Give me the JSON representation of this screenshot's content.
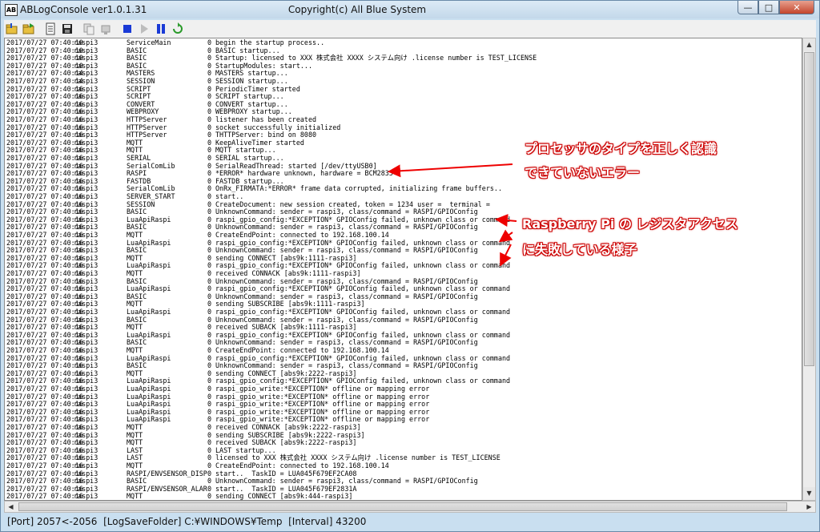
{
  "window": {
    "app_title": "ABLogConsole ver1.0.1.31",
    "copyright": "Copyright(c) All Blue System",
    "app_icon_text": "AB",
    "min_label": "—",
    "max_label": "□",
    "close_label": "✕"
  },
  "toolbar": {
    "icons": [
      "folder-open-icon",
      "folder-save-icon",
      "new-doc-icon",
      "save-disk-icon",
      "copy-icon",
      "connect-icon",
      "stop-icon",
      "play-icon",
      "pause-icon",
      "refresh-icon"
    ]
  },
  "colors": {
    "stop": "#1a3ad6",
    "annotation_outline": "#cc0000"
  },
  "log": [
    [
      "2017/07/27 07:40:10",
      "raspi3",
      "ServiceMain",
      "0",
      "begin the startup process.."
    ],
    [
      "2017/07/27 07:40:10",
      "raspi3",
      "BASIC",
      "0",
      "BASIC startup..."
    ],
    [
      "2017/07/27 07:40:10",
      "raspi3",
      "BASIC",
      "0",
      "Startup: licensed to XXX 株式会社 XXXX システム向け .license number is TEST_LICENSE"
    ],
    [
      "2017/07/27 07:40:10",
      "raspi3",
      "BASIC",
      "0",
      "StartupModules: start..."
    ],
    [
      "2017/07/27 07:40:14",
      "raspi3",
      "MASTERS",
      "0",
      "MASTERS startup..."
    ],
    [
      "2017/07/27 07:40:14",
      "raspi3",
      "SESSION",
      "0",
      "SESSION startup..."
    ],
    [
      "2017/07/27 07:40:16",
      "raspi3",
      "SCRIPT",
      "0",
      "PeriodicTimer started"
    ],
    [
      "2017/07/27 07:40:16",
      "raspi3",
      "SCRIPT",
      "0",
      "SCRIPT startup..."
    ],
    [
      "2017/07/27 07:40:16",
      "raspi3",
      "CONVERT",
      "0",
      "CONVERT startup..."
    ],
    [
      "2017/07/27 07:40:16",
      "raspi3",
      "WEBPROXY",
      "0",
      "WEBPROXY startup..."
    ],
    [
      "2017/07/27 07:40:16",
      "raspi3",
      "HTTPServer",
      "0",
      "listener has been created"
    ],
    [
      "2017/07/27 07:40:16",
      "raspi3",
      "HTTPServer",
      "0",
      "socket successfully initialized"
    ],
    [
      "2017/07/27 07:40:16",
      "raspi3",
      "HTTPServer",
      "0",
      "THTTPServer: bind on 8080"
    ],
    [
      "2017/07/27 07:40:16",
      "raspi3",
      "MQTT",
      "0",
      "KeepAliveTimer started"
    ],
    [
      "2017/07/27 07:40:16",
      "raspi3",
      "MQTT",
      "0",
      "MQTT startup..."
    ],
    [
      "2017/07/27 07:40:16",
      "raspi3",
      "SERIAL",
      "0",
      "SERIAL startup..."
    ],
    [
      "2017/07/27 07:40:16",
      "raspi3",
      "SerialComLib",
      "0",
      "SerialReadThread: started [/dev/ttyUSB0]"
    ],
    [
      "2017/07/27 07:40:16",
      "raspi3",
      "RASPI",
      "0",
      "*ERROR* hardware unknown, hardware = BCM2835"
    ],
    [
      "2017/07/27 07:40:16",
      "raspi3",
      "FASTDB",
      "0",
      "FASTDB startup..."
    ],
    [
      "2017/07/27 07:40:16",
      "raspi3",
      "SerialComLib",
      "0",
      "OnRx_FIRMATA:*ERROR* frame data corrupted, initializing frame buffers.."
    ],
    [
      "2017/07/27 07:40:16",
      "raspi3",
      "SERVER_START",
      "0",
      "start.."
    ],
    [
      "2017/07/27 07:40:16",
      "raspi3",
      "SESSION",
      "0",
      "CreateDocument: new session created, token = 1234 user =  terminal ="
    ],
    [
      "2017/07/27 07:40:16",
      "raspi3",
      "BASIC",
      "0",
      "UnknownCommand: sender = raspi3, class/command = RASPI/GPIOConfig"
    ],
    [
      "2017/07/27 07:40:16",
      "raspi3",
      "LuaApiRaspi",
      "0",
      "raspi_gpio_config:*EXCEPTION* GPIOConfig failed, unknown class or command"
    ],
    [
      "2017/07/27 07:40:16",
      "raspi3",
      "BASIC",
      "0",
      "UnknownCommand: sender = raspi3, class/command = RASPI/GPIOConfig"
    ],
    [
      "2017/07/27 07:40:16",
      "raspi3",
      "MQTT",
      "0",
      "CreateEndPoint: connected to 192.168.100.14"
    ],
    [
      "2017/07/27 07:40:16",
      "raspi3",
      "LuaApiRaspi",
      "0",
      "raspi_gpio_config:*EXCEPTION* GPIOConfig failed, unknown class or command"
    ],
    [
      "2017/07/27 07:40:16",
      "raspi3",
      "BASIC",
      "0",
      "UnknownCommand: sender = raspi3, class/command = RASPI/GPIOConfig"
    ],
    [
      "2017/07/27 07:40:16",
      "raspi3",
      "MQTT",
      "0",
      "sending CONNECT [abs9k:1111-raspi3]"
    ],
    [
      "2017/07/27 07:40:16",
      "raspi3",
      "LuaApiRaspi",
      "0",
      "raspi_gpio_config:*EXCEPTION* GPIOConfig failed, unknown class or command"
    ],
    [
      "2017/07/27 07:40:16",
      "raspi3",
      "MQTT",
      "0",
      "received CONNACK [abs9k:1111-raspi3]"
    ],
    [
      "2017/07/27 07:40:16",
      "raspi3",
      "BASIC",
      "0",
      "UnknownCommand: sender = raspi3, class/command = RASPI/GPIOConfig"
    ],
    [
      "2017/07/27 07:40:16",
      "raspi3",
      "LuaApiRaspi",
      "0",
      "raspi_gpio_config:*EXCEPTION* GPIOConfig failed, unknown class or command"
    ],
    [
      "2017/07/27 07:40:16",
      "raspi3",
      "BASIC",
      "0",
      "UnknownCommand: sender = raspi3, class/command = RASPI/GPIOConfig"
    ],
    [
      "2017/07/27 07:40:16",
      "raspi3",
      "MQTT",
      "0",
      "sending SUBSCRIBE [abs9k:1111-raspi3]"
    ],
    [
      "2017/07/27 07:40:16",
      "raspi3",
      "LuaApiRaspi",
      "0",
      "raspi_gpio_config:*EXCEPTION* GPIOConfig failed, unknown class or command"
    ],
    [
      "2017/07/27 07:40:16",
      "raspi3",
      "BASIC",
      "0",
      "UnknownCommand: sender = raspi3, class/command = RASPI/GPIOConfig"
    ],
    [
      "2017/07/27 07:40:16",
      "raspi3",
      "MQTT",
      "0",
      "received SUBACK [abs9k:1111-raspi3]"
    ],
    [
      "2017/07/27 07:40:16",
      "raspi3",
      "LuaApiRaspi",
      "0",
      "raspi_gpio_config:*EXCEPTION* GPIOConfig failed, unknown class or command"
    ],
    [
      "2017/07/27 07:40:16",
      "raspi3",
      "BASIC",
      "0",
      "UnknownCommand: sender = raspi3, class/command = RASPI/GPIOConfig"
    ],
    [
      "2017/07/27 07:40:16",
      "raspi3",
      "MQTT",
      "0",
      "CreateEndPoint: connected to 192.168.100.14"
    ],
    [
      "2017/07/27 07:40:16",
      "raspi3",
      "LuaApiRaspi",
      "0",
      "raspi_gpio_config:*EXCEPTION* GPIOConfig failed, unknown class or command"
    ],
    [
      "2017/07/27 07:40:16",
      "raspi3",
      "BASIC",
      "0",
      "UnknownCommand: sender = raspi3, class/command = RASPI/GPIOConfig"
    ],
    [
      "2017/07/27 07:40:16",
      "raspi3",
      "MQTT",
      "0",
      "sending CONNECT [abs9k:2222-raspi3]"
    ],
    [
      "2017/07/27 07:40:16",
      "raspi3",
      "LuaApiRaspi",
      "0",
      "raspi_gpio_config:*EXCEPTION* GPIOConfig failed, unknown class or command"
    ],
    [
      "2017/07/27 07:40:16",
      "raspi3",
      "LuaApiRaspi",
      "0",
      "raspi_gpio_write:*EXCEPTION* offline or mapping error"
    ],
    [
      "2017/07/27 07:40:16",
      "raspi3",
      "LuaApiRaspi",
      "0",
      "raspi_gpio_write:*EXCEPTION* offline or mapping error"
    ],
    [
      "2017/07/27 07:40:16",
      "raspi3",
      "LuaApiRaspi",
      "0",
      "raspi_gpio_write:*EXCEPTION* offline or mapping error"
    ],
    [
      "2017/07/27 07:40:16",
      "raspi3",
      "LuaApiRaspi",
      "0",
      "raspi_gpio_write:*EXCEPTION* offline or mapping error"
    ],
    [
      "2017/07/27 07:40:16",
      "raspi3",
      "LuaApiRaspi",
      "0",
      "raspi_gpio_write:*EXCEPTION* offline or mapping error"
    ],
    [
      "2017/07/27 07:40:16",
      "raspi3",
      "MQTT",
      "0",
      "received CONNACK [abs9k:2222-raspi3]"
    ],
    [
      "2017/07/27 07:40:16",
      "raspi3",
      "MQTT",
      "0",
      "sending SUBSCRIBE [abs9k:2222-raspi3]"
    ],
    [
      "2017/07/27 07:40:16",
      "raspi3",
      "MQTT",
      "0",
      "received SUBACK [abs9k:2222-raspi3]"
    ],
    [
      "2017/07/27 07:40:16",
      "raspi3",
      "LAST",
      "0",
      "LAST startup..."
    ],
    [
      "2017/07/27 07:40:16",
      "raspi3",
      "LAST",
      "0",
      "licensed to XXX 株式会社 XXXX システム向け .license number is TEST_LICENSE"
    ],
    [
      "2017/07/27 07:40:16",
      "raspi3",
      "MQTT",
      "0",
      "CreateEndPoint: connected to 192.168.100.14"
    ],
    [
      "2017/07/27 07:40:16",
      "raspi3",
      "RASPI/ENVSENSOR_DISP",
      "0",
      "start..  TaskID = LUA045F679EF2CA08"
    ],
    [
      "2017/07/27 07:40:16",
      "raspi3",
      "BASIC",
      "0",
      "UnknownCommand: sender = raspi3, class/command = RASPI/GPIOConfig"
    ],
    [
      "2017/07/27 07:40:16",
      "raspi3",
      "RASPI/ENVSENSOR_ALAR",
      "0",
      "start..  TaskID = LUA045F679EF2831A"
    ],
    [
      "2017/07/27 07:40:16",
      "raspi3",
      "MQTT",
      "0",
      "sending CONNECT [abs9k:444-raspi3]"
    ]
  ],
  "annotations": {
    "a1_line1": "プロセッサのタイプを正しく認識",
    "a1_line2": "できていないエラー",
    "a2_line1": "Raspberry Pi の レジスタアクセス",
    "a2_line2": "に失敗している様子"
  },
  "status": {
    "port": "[Port] 2057<-2056",
    "logsavefolder": "[LogSaveFolder] C:¥WINDOWS¥Temp",
    "interval": "[Interval] 43200"
  }
}
